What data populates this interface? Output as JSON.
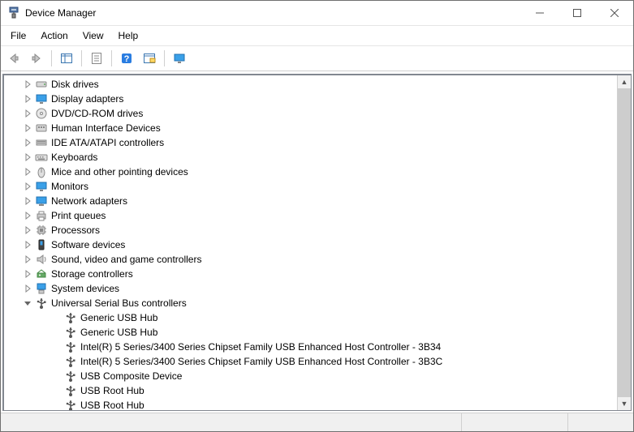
{
  "window": {
    "title": "Device Manager"
  },
  "menubar": {
    "items": [
      "File",
      "Action",
      "View",
      "Help"
    ]
  },
  "tree": {
    "categories": [
      {
        "label": "Disk drives",
        "icon": "disk"
      },
      {
        "label": "Display adapters",
        "icon": "display"
      },
      {
        "label": "DVD/CD-ROM drives",
        "icon": "dvd"
      },
      {
        "label": "Human Interface Devices",
        "icon": "hid"
      },
      {
        "label": "IDE ATA/ATAPI controllers",
        "icon": "ide"
      },
      {
        "label": "Keyboards",
        "icon": "keyboard"
      },
      {
        "label": "Mice and other pointing devices",
        "icon": "mouse"
      },
      {
        "label": "Monitors",
        "icon": "monitor"
      },
      {
        "label": "Network adapters",
        "icon": "network"
      },
      {
        "label": "Print queues",
        "icon": "printer"
      },
      {
        "label": "Processors",
        "icon": "cpu"
      },
      {
        "label": "Software devices",
        "icon": "software"
      },
      {
        "label": "Sound, video and game controllers",
        "icon": "sound"
      },
      {
        "label": "Storage controllers",
        "icon": "storage"
      },
      {
        "label": "System devices",
        "icon": "system"
      }
    ],
    "expanded": {
      "label": "Universal Serial Bus controllers",
      "icon": "usb",
      "children": [
        "Generic USB Hub",
        "Generic USB Hub",
        "Intel(R) 5 Series/3400 Series Chipset Family USB Enhanced Host Controller - 3B34",
        "Intel(R) 5 Series/3400 Series Chipset Family USB Enhanced Host Controller - 3B3C",
        "USB Composite Device",
        "USB Root Hub",
        "USB Root Hub"
      ]
    }
  }
}
